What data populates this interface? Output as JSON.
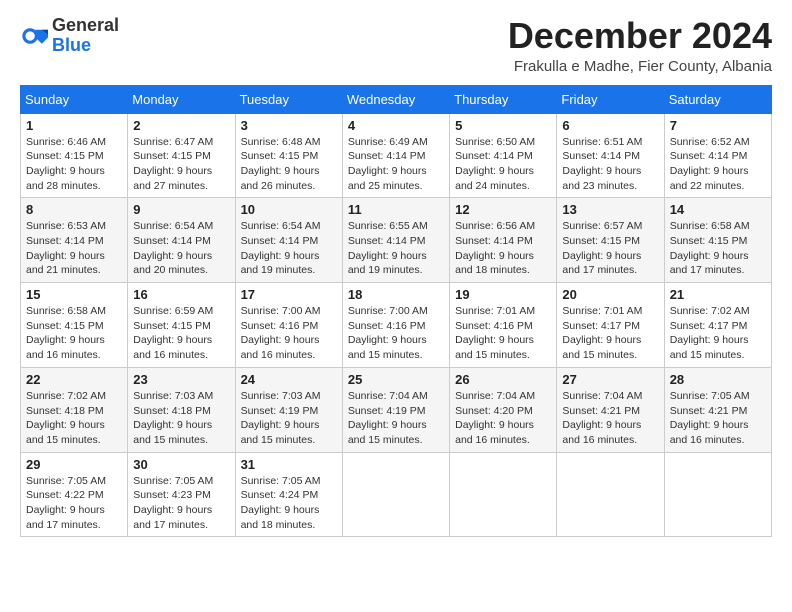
{
  "header": {
    "logo_general": "General",
    "logo_blue": "Blue",
    "month_title": "December 2024",
    "location": "Frakulla e Madhe, Fier County, Albania"
  },
  "days_of_week": [
    "Sunday",
    "Monday",
    "Tuesday",
    "Wednesday",
    "Thursday",
    "Friday",
    "Saturday"
  ],
  "weeks": [
    [
      {
        "day": "1",
        "sunrise": "6:46 AM",
        "sunset": "4:15 PM",
        "daylight": "9 hours and 28 minutes."
      },
      {
        "day": "2",
        "sunrise": "6:47 AM",
        "sunset": "4:15 PM",
        "daylight": "9 hours and 27 minutes."
      },
      {
        "day": "3",
        "sunrise": "6:48 AM",
        "sunset": "4:15 PM",
        "daylight": "9 hours and 26 minutes."
      },
      {
        "day": "4",
        "sunrise": "6:49 AM",
        "sunset": "4:14 PM",
        "daylight": "9 hours and 25 minutes."
      },
      {
        "day": "5",
        "sunrise": "6:50 AM",
        "sunset": "4:14 PM",
        "daylight": "9 hours and 24 minutes."
      },
      {
        "day": "6",
        "sunrise": "6:51 AM",
        "sunset": "4:14 PM",
        "daylight": "9 hours and 23 minutes."
      },
      {
        "day": "7",
        "sunrise": "6:52 AM",
        "sunset": "4:14 PM",
        "daylight": "9 hours and 22 minutes."
      }
    ],
    [
      {
        "day": "8",
        "sunrise": "6:53 AM",
        "sunset": "4:14 PM",
        "daylight": "9 hours and 21 minutes."
      },
      {
        "day": "9",
        "sunrise": "6:54 AM",
        "sunset": "4:14 PM",
        "daylight": "9 hours and 20 minutes."
      },
      {
        "day": "10",
        "sunrise": "6:54 AM",
        "sunset": "4:14 PM",
        "daylight": "9 hours and 19 minutes."
      },
      {
        "day": "11",
        "sunrise": "6:55 AM",
        "sunset": "4:14 PM",
        "daylight": "9 hours and 19 minutes."
      },
      {
        "day": "12",
        "sunrise": "6:56 AM",
        "sunset": "4:14 PM",
        "daylight": "9 hours and 18 minutes."
      },
      {
        "day": "13",
        "sunrise": "6:57 AM",
        "sunset": "4:15 PM",
        "daylight": "9 hours and 17 minutes."
      },
      {
        "day": "14",
        "sunrise": "6:58 AM",
        "sunset": "4:15 PM",
        "daylight": "9 hours and 17 minutes."
      }
    ],
    [
      {
        "day": "15",
        "sunrise": "6:58 AM",
        "sunset": "4:15 PM",
        "daylight": "9 hours and 16 minutes."
      },
      {
        "day": "16",
        "sunrise": "6:59 AM",
        "sunset": "4:15 PM",
        "daylight": "9 hours and 16 minutes."
      },
      {
        "day": "17",
        "sunrise": "7:00 AM",
        "sunset": "4:16 PM",
        "daylight": "9 hours and 16 minutes."
      },
      {
        "day": "18",
        "sunrise": "7:00 AM",
        "sunset": "4:16 PM",
        "daylight": "9 hours and 15 minutes."
      },
      {
        "day": "19",
        "sunrise": "7:01 AM",
        "sunset": "4:16 PM",
        "daylight": "9 hours and 15 minutes."
      },
      {
        "day": "20",
        "sunrise": "7:01 AM",
        "sunset": "4:17 PM",
        "daylight": "9 hours and 15 minutes."
      },
      {
        "day": "21",
        "sunrise": "7:02 AM",
        "sunset": "4:17 PM",
        "daylight": "9 hours and 15 minutes."
      }
    ],
    [
      {
        "day": "22",
        "sunrise": "7:02 AM",
        "sunset": "4:18 PM",
        "daylight": "9 hours and 15 minutes."
      },
      {
        "day": "23",
        "sunrise": "7:03 AM",
        "sunset": "4:18 PM",
        "daylight": "9 hours and 15 minutes."
      },
      {
        "day": "24",
        "sunrise": "7:03 AM",
        "sunset": "4:19 PM",
        "daylight": "9 hours and 15 minutes."
      },
      {
        "day": "25",
        "sunrise": "7:04 AM",
        "sunset": "4:19 PM",
        "daylight": "9 hours and 15 minutes."
      },
      {
        "day": "26",
        "sunrise": "7:04 AM",
        "sunset": "4:20 PM",
        "daylight": "9 hours and 16 minutes."
      },
      {
        "day": "27",
        "sunrise": "7:04 AM",
        "sunset": "4:21 PM",
        "daylight": "9 hours and 16 minutes."
      },
      {
        "day": "28",
        "sunrise": "7:05 AM",
        "sunset": "4:21 PM",
        "daylight": "9 hours and 16 minutes."
      }
    ],
    [
      {
        "day": "29",
        "sunrise": "7:05 AM",
        "sunset": "4:22 PM",
        "daylight": "9 hours and 17 minutes."
      },
      {
        "day": "30",
        "sunrise": "7:05 AM",
        "sunset": "4:23 PM",
        "daylight": "9 hours and 17 minutes."
      },
      {
        "day": "31",
        "sunrise": "7:05 AM",
        "sunset": "4:24 PM",
        "daylight": "9 hours and 18 minutes."
      },
      null,
      null,
      null,
      null
    ]
  ],
  "labels": {
    "sunrise": "Sunrise:",
    "sunset": "Sunset:",
    "daylight": "Daylight:"
  }
}
